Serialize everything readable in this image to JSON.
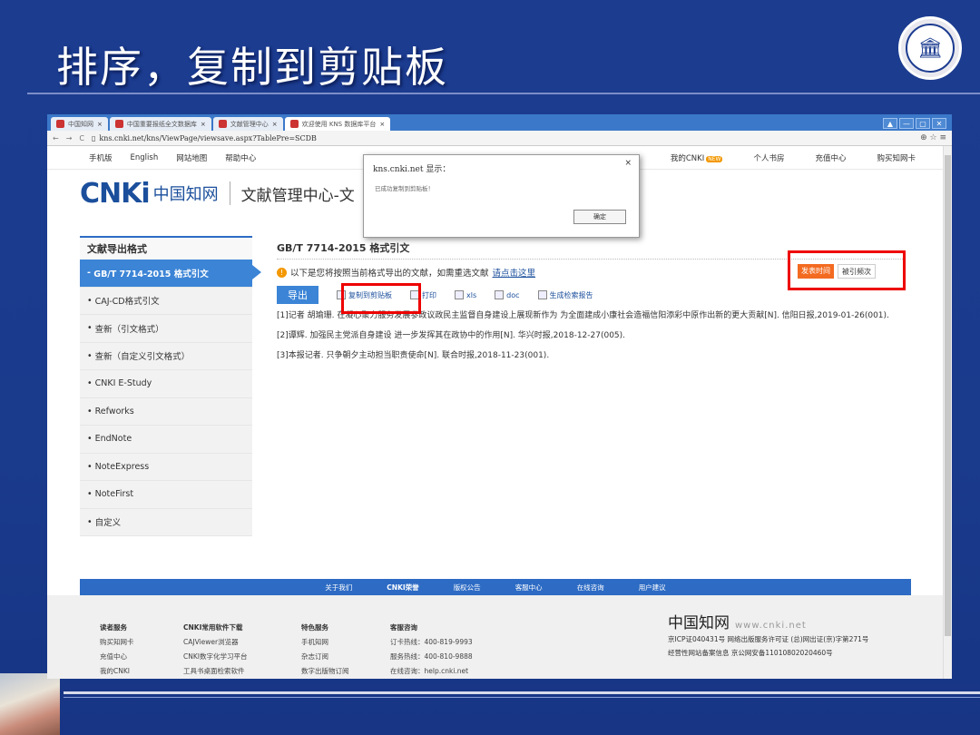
{
  "slide": {
    "title": "排序，复制到剪贴板"
  },
  "browser": {
    "tabs": [
      "中国知网",
      "中国重要报纸全文数据库",
      "文献管理中心",
      "欢迎使用 KNS 数据库平台"
    ],
    "address": "kns.cnki.net/kns/ViewPage/viewsave.aspx?TablePre=SCDB",
    "window_buttons": [
      "▲",
      "—",
      "▢",
      "✕"
    ]
  },
  "topnav": {
    "left": [
      "手机版",
      "English",
      "网站地图",
      "帮助中心"
    ],
    "right": [
      "我的CNKI",
      "个人书房",
      "充值中心",
      "购买知网卡"
    ],
    "new_badge": "NEW"
  },
  "brand": {
    "mark": "CNKi",
    "cn": "中国知网",
    "sub": "cnki.net",
    "title": "文献管理中心-文"
  },
  "dialog": {
    "title": "kns.cnki.net 显示：",
    "message": "已成功复制到剪贴板！",
    "ok": "确定",
    "close": "×"
  },
  "sidebar": {
    "heading": "文献导出格式",
    "items": [
      "GB/T 7714-2015 格式引文",
      "CAJ-CD格式引文",
      "查新（引文格式）",
      "查新（自定义引文格式）",
      "CNKI E-Study",
      "Refworks",
      "EndNote",
      "NoteExpress",
      "NoteFirst",
      "自定义"
    ]
  },
  "main": {
    "title": "GB/T 7714-2015 格式引文",
    "notice_prefix": "以下是您将按照当前格式导出的文献，如需重选文献",
    "notice_link": "请点击这里",
    "toolbar": {
      "export": "导出",
      "copy": "复制到剪贴板",
      "print": "打印",
      "xls": "xls",
      "doc": "doc",
      "report": "生成检索报告"
    },
    "sort": {
      "by_date": "发表时间",
      "by_cited": "被引频次"
    },
    "references": [
      "[1]记者 胡瑜珊. 在凝心聚力服务发展参政议政民主监督自身建设上展现新作为 为全面建成小康社会造福信阳添彩中原作出新的更大贡献[N]. 信阳日报,2019-01-26(001).",
      "[2]谭辉. 加强民主党派自身建设 进一步发挥其在政协中的作用[N]. 华兴时报,2018-12-27(005).",
      "[3]本报记者. 只争朝夕主动担当职责使命[N]. 联合时报,2018-11-23(001)."
    ]
  },
  "footer": {
    "bar": [
      "关于我们",
      "CNKI荣誉",
      "版权公告",
      "客服中心",
      "在线咨询",
      "用户建议"
    ],
    "cols": [
      {
        "h": "读者服务",
        "items": [
          "购买知网卡",
          "充值中心",
          "我的CNKI"
        ]
      },
      {
        "h": "CNKI常用软件下载",
        "items": [
          "CAJViewer浏览器",
          "CNKI数字化学习平台",
          "工具书桌面检索软件"
        ]
      },
      {
        "h": "特色服务",
        "items": [
          "手机知网",
          "杂志订阅",
          "数字出版物订阅"
        ]
      },
      {
        "h": "客服咨询",
        "items": [
          "订卡热线：400-819-9993",
          "服务热线：400-810-9888",
          "在线咨询：help.cnki.net"
        ]
      }
    ],
    "right": {
      "logo": "中国知网",
      "url": "www.cnki.net",
      "icp": "京ICP证040431号 网络出版服务许可证 (总)网出证(京)字第271号",
      "record": "经营性网站备案信息 京公网安备11010802020460号"
    }
  }
}
